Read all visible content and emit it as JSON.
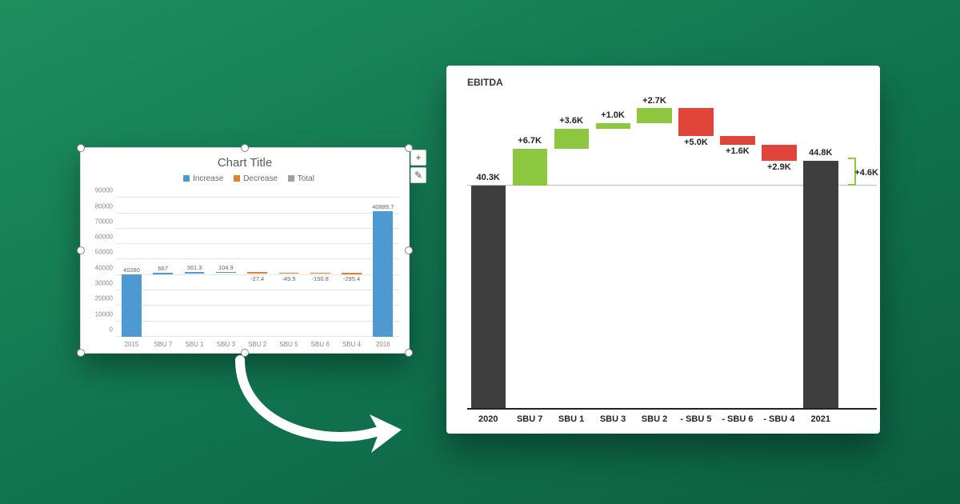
{
  "chart_data": [
    {
      "id": "left_excel_default",
      "type": "bar",
      "subtype": "waterfall",
      "title": "Chart Title",
      "legend": [
        {
          "name": "Increase",
          "color": "#4f99d3"
        },
        {
          "name": "Decrease",
          "color": "#e08030"
        },
        {
          "name": "Total",
          "color": "#a0a0a0"
        }
      ],
      "ylim": [
        0,
        90000
      ],
      "ytick_step": 10000,
      "categories": [
        "2015",
        "SBU 7",
        "SBU 1",
        "SBU 3",
        "SBU 2",
        "SBU 5",
        "SBU 6",
        "SBU 4",
        "2016"
      ],
      "values": [
        40280,
        667,
        361.3,
        104.9,
        -27.4,
        -49.9,
        -150.8,
        -295.4,
        40889.7
      ],
      "value_kind": [
        "total",
        "inc",
        "inc",
        "inc",
        "dec",
        "dec",
        "dec",
        "dec",
        "total"
      ]
    },
    {
      "id": "right_ebitda_waterfall",
      "type": "bar",
      "subtype": "waterfall",
      "title": "EBITDA",
      "categories": [
        "2020",
        "SBU 7",
        "SBU 1",
        "SBU 3",
        "SBU 2",
        "- SBU 5",
        "- SBU 6",
        "- SBU 4",
        "2021"
      ],
      "values": [
        40.3,
        6.7,
        3.6,
        1.0,
        2.7,
        -5.0,
        -1.6,
        -2.9,
        44.8
      ],
      "display_labels": [
        "40.3K",
        "+6.7K",
        "+3.6K",
        "+1.0K",
        "+2.7K",
        "+5.0K",
        "+1.6K",
        "+2.9K",
        "44.8K"
      ],
      "value_kind": [
        "total",
        "inc",
        "inc",
        "inc",
        "inc",
        "dec",
        "dec",
        "dec",
        "total"
      ],
      "delta": {
        "label": "+4.6K",
        "value": 4.6
      },
      "unit": "K",
      "ylim_implied": [
        0,
        55
      ]
    }
  ],
  "left": {
    "title": "Chart Title",
    "legend_inc": "Increase",
    "legend_dec": "Decrease",
    "legend_tot": "Total",
    "yticks": [
      "0",
      "10000",
      "20000",
      "30000",
      "40000",
      "50000",
      "60000",
      "70000",
      "80000",
      "90000"
    ],
    "xticks": [
      "2015",
      "SBU 7",
      "SBU 1",
      "SBU 3",
      "SBU 2",
      "SBU 5",
      "SBU 6",
      "SBU 4",
      "2016"
    ],
    "data_labels": [
      "40280",
      "667",
      "361.3",
      "104.9",
      "-27.4",
      "-49.9",
      "-150.8",
      "-295.4",
      "40889.7"
    ],
    "ctrl_plus_glyph": "+",
    "ctrl_brush_glyph": "✎"
  },
  "right": {
    "title": "EBITDA",
    "xticks": [
      "2020",
      "SBU 7",
      "SBU 1",
      "SBU 3",
      "SBU 2",
      "- SBU 5",
      "- SBU 6",
      "- SBU 4",
      "2021"
    ],
    "data_labels": [
      "40.3K",
      "+6.7K",
      "+3.6K",
      "+1.0K",
      "+2.7K",
      "+5.0K",
      "+1.6K",
      "+2.9K",
      "44.8K"
    ],
    "delta_label": "+4.6K"
  }
}
